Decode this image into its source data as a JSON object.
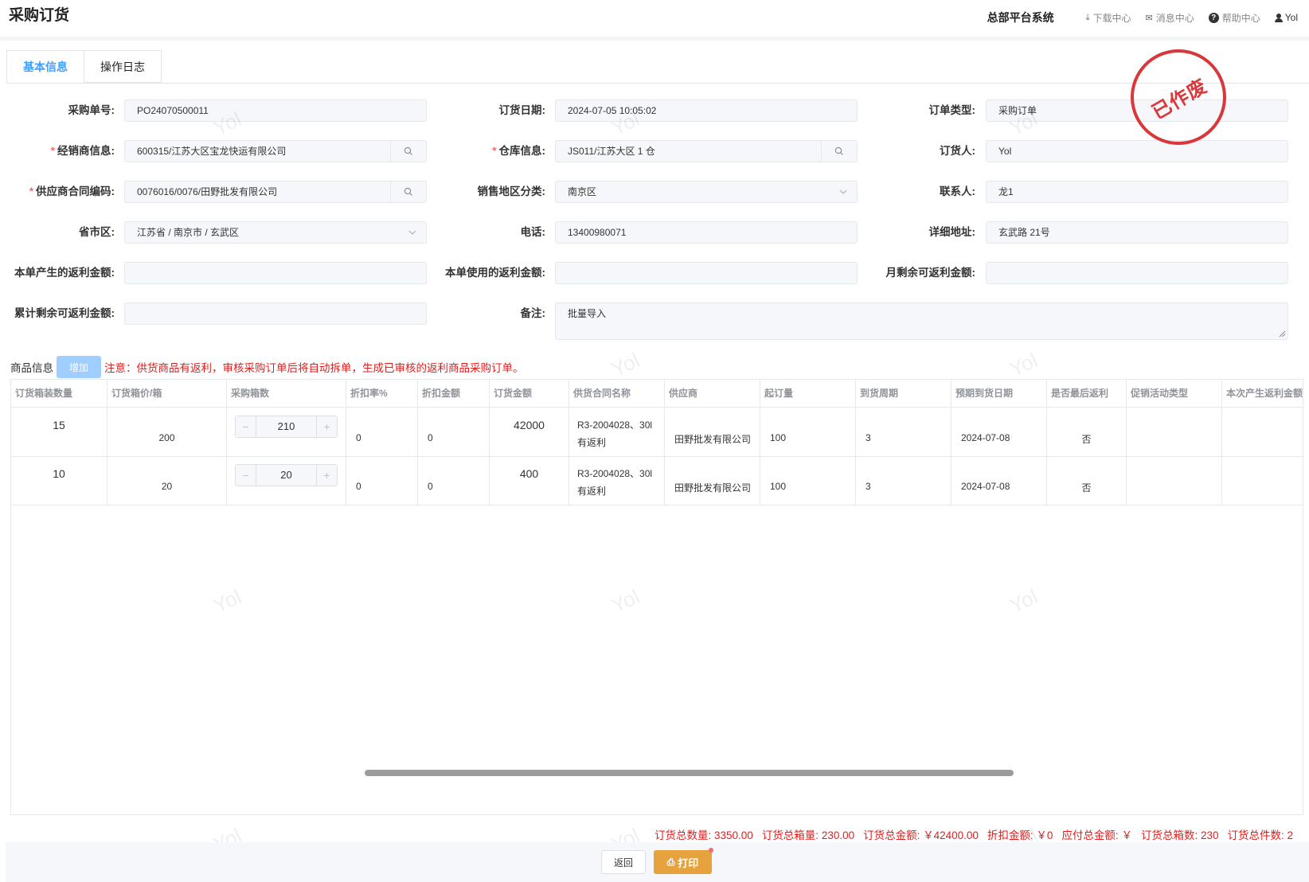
{
  "header": {
    "title": "采购订货",
    "system_name": "总部平台系统",
    "links": {
      "download": "下载中心",
      "messages": "消息中心",
      "help": "帮助中心",
      "user": "Yol"
    }
  },
  "tabs": [
    {
      "label": "基本信息"
    },
    {
      "label": "操作日志"
    }
  ],
  "stamp": "已作废",
  "watermark": "Yol",
  "form": {
    "po_number": {
      "label": "采购单号:",
      "value": "PO24070500011"
    },
    "order_date": {
      "label": "订货日期:",
      "value": "2024-07-05 10:05:02"
    },
    "order_type": {
      "label": "订单类型:",
      "value": "采购订单"
    },
    "dealer": {
      "label": "经销商信息:",
      "value": "600315/江苏大区宝龙快运有限公司"
    },
    "warehouse": {
      "label": "仓库信息:",
      "value": "JS011/江苏大区 1 仓"
    },
    "orderer": {
      "label": "订货人:",
      "value": "Yol"
    },
    "contract": {
      "label": "供应商合同编码:",
      "value": "0076016/0076/田野批发有限公司"
    },
    "sales_region": {
      "label": "销售地区分类:",
      "value": "南京区"
    },
    "contact": {
      "label": "联系人:",
      "value": "龙1"
    },
    "province_city": {
      "label": "省市区:",
      "value": "江苏省 / 南京市 / 玄武区"
    },
    "phone": {
      "label": "电话:",
      "value": "13400980071"
    },
    "address": {
      "label": "详细地址:",
      "value": "玄武路 21号"
    },
    "rebate_generated": {
      "label": "本单产生的返利金额:",
      "value": ""
    },
    "rebate_used": {
      "label": "本单使用的返利金额:",
      "value": ""
    },
    "monthly_rebate": {
      "label": "月剩余可返利金额:",
      "value": ""
    },
    "total_rebate": {
      "label": "累计剩余可返利金额:",
      "value": ""
    },
    "remark": {
      "label": "备注:",
      "value": "批量导入"
    }
  },
  "goods": {
    "title": "商品信息",
    "add_label": "增加",
    "notice": "注意：供货商品有返利，审核采购订单后将自动拆单，生成已审核的返利商品采购订单。",
    "columns": [
      "订货箱装数量",
      "订货箱价/箱",
      "采购箱数",
      "折扣率%",
      "折扣金额",
      "订货金额",
      "供货合同名称",
      "供应商",
      "起订量",
      "到货周期",
      "预期到货日期",
      "是否最后返利",
      "促销活动类型",
      "本次产生返利金额"
    ],
    "rows": [
      {
        "pack_qty": "15",
        "box_price": "200",
        "boxes": "210",
        "discount_rate": "0",
        "discount_amount": "0",
        "amount": "42000",
        "contract_name": "R3-2004028、30l 有返利",
        "supplier": "田野批发有限公司",
        "min_qty": "100",
        "cycle": "3",
        "arrival_date": "2024-07-08",
        "last_rebate": "否",
        "promo_type": "",
        "rebate_amount": ""
      },
      {
        "pack_qty": "10",
        "box_price": "20",
        "boxes": "20",
        "discount_rate": "0",
        "discount_amount": "0",
        "amount": "400",
        "contract_name": "R3-2004028、30l 有返利",
        "supplier": "田野批发有限公司",
        "min_qty": "100",
        "cycle": "3",
        "arrival_date": "2024-07-08",
        "last_rebate": "否",
        "promo_type": "",
        "rebate_amount": ""
      }
    ]
  },
  "totals": {
    "total_qty": "订货总数量: 3350.00",
    "total_boxes_vol": "订货总箱量: 230.00",
    "total_amount": "订货总金额: ￥42400.00",
    "discount": "折扣金额: ￥0",
    "payable": "应付总金额: ￥",
    "box_count": "订货总箱数: 230",
    "item_count": "订货总件数: 2"
  },
  "footer": {
    "back_label": "返回",
    "print_label": "打印"
  },
  "colors": {
    "accent": "#409eff",
    "warning": "#e6a23c",
    "danger": "#e01e1e",
    "stamp": "#d9383a"
  }
}
